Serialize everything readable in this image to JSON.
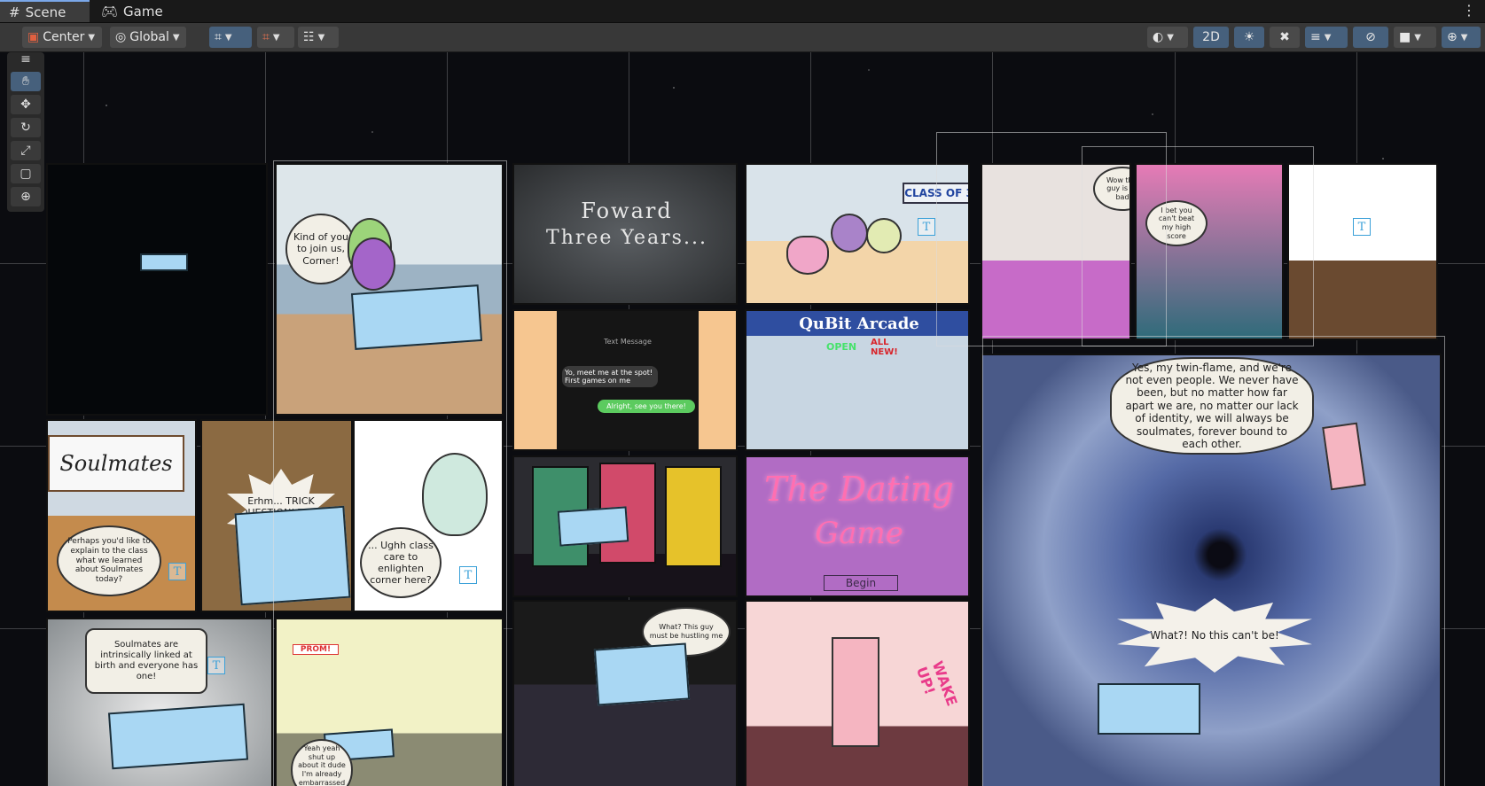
{
  "tabs": [
    {
      "icon": "grid-icon",
      "label": "Scene"
    },
    {
      "icon": "gamepad-icon",
      "label": "Game"
    }
  ],
  "toolbar": {
    "pivot_mode": "Center",
    "pivot_rotation": "Global",
    "mode_2d": "2D"
  },
  "tools": [
    "hand",
    "move",
    "rotate",
    "scale",
    "rect",
    "transform"
  ],
  "comic": {
    "panel_1_bubble": "Kind of you to join us, Corner!",
    "panel_chalk_title_line1": "Foward",
    "panel_chalk_title_line2": "Three Years...",
    "banner_class": "CLASS OF 3",
    "whiteboard_text": "Soulmates",
    "teacher_bubble": "Perhaps you'd like to explain to the class what we learned about Soulmates today?",
    "trick_burst": "Erhm... TRICK QUESTION! They don't exist?",
    "ughh_bubble": "... Ughh class care to enlighten corner here?",
    "phone_header": "Text Message",
    "phone_msg_in": "Yo, meet me at the spot! First games on me",
    "phone_msg_out": "Alright, see you there!",
    "arcade_sign": "QuBit Arcade",
    "arcade_open": "OPEN",
    "arcade_new": "ALL NEW!",
    "soulmates_bubble": "Soulmates are intrinsically linked at birth and everyone has one!",
    "prom_banner": "PROM!",
    "yeah_bubble": "Yeah yeah shut up about it dude I'm already embarrassed enough",
    "dating_game_title_1": "The Dating",
    "dating_game_title_2": "Game",
    "dating_game_begin": "Begin",
    "twin_flame_bubble": "Yes, my twin-flame, and we're not even people. We never have been, but no matter how far apart we are, no matter our lack of identity, we will always be soulmates, forever bound to each other.",
    "what_burst": "What?! No this can't be!",
    "wake_up": "WAKE UP!"
  }
}
